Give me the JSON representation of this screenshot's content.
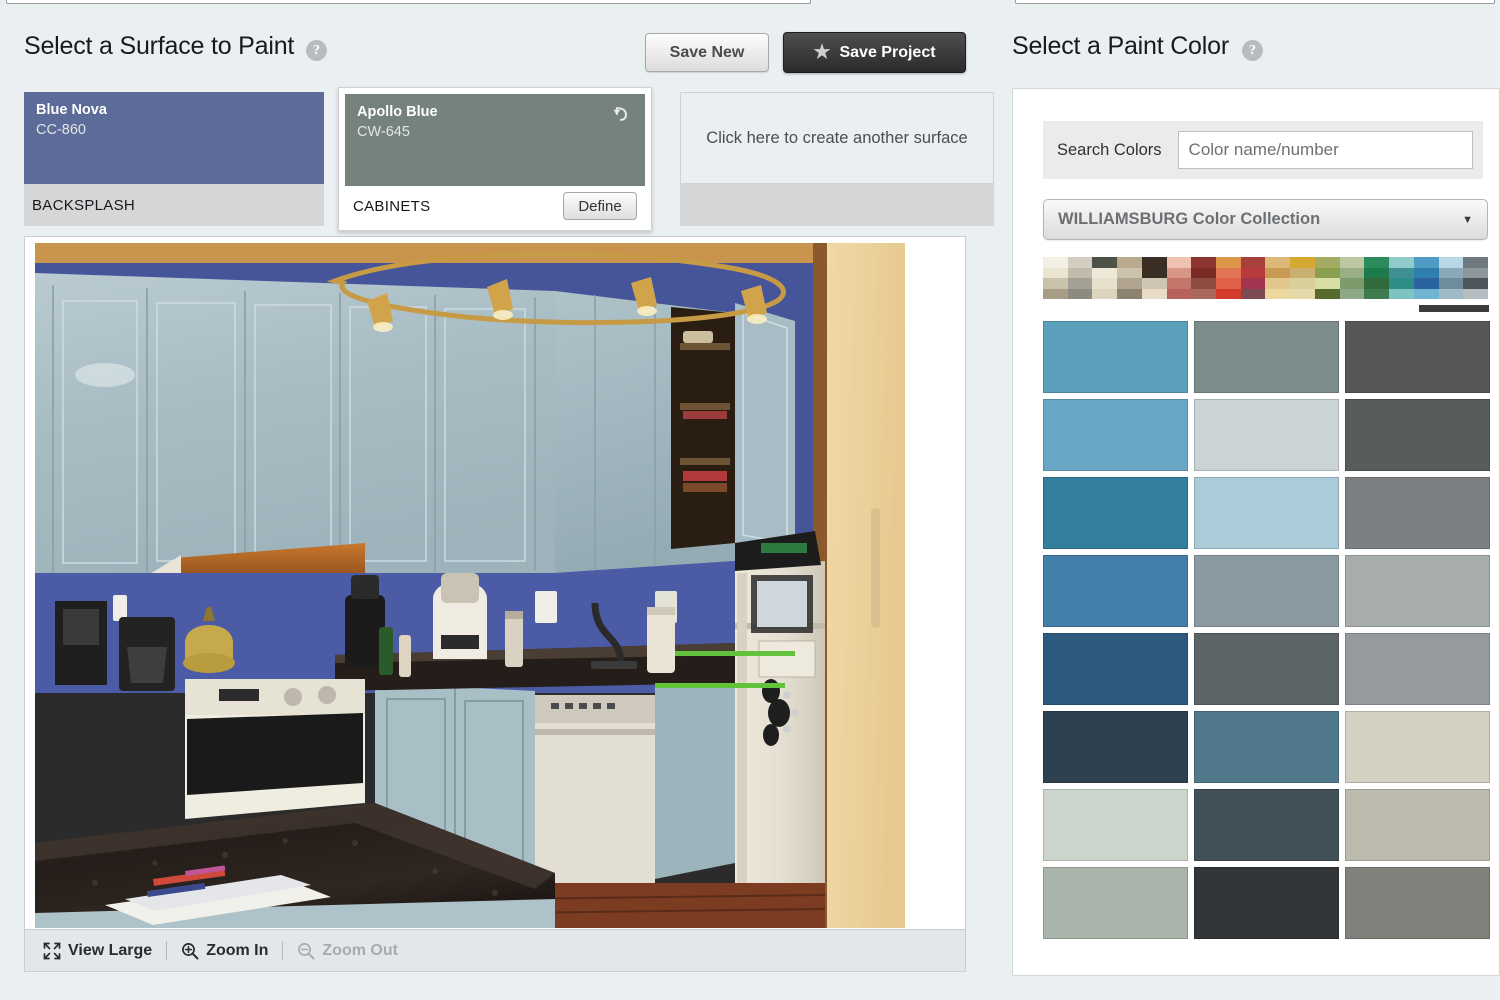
{
  "left": {
    "title": "Select a Surface to Paint",
    "help_icon": "help-icon",
    "save_new_label": "Save New",
    "save_project_label": "Save Project",
    "star_glyph": "★",
    "surfaces": [
      {
        "color_name": "Blue Nova",
        "color_code": "CC-860",
        "label": "BACKSPLASH",
        "hex": "#5c6b97",
        "selected": false
      },
      {
        "color_name": "Apollo Blue",
        "color_code": "CW-645",
        "label": "CABINETS",
        "hex": "#76837d",
        "selected": true,
        "define_label": "Define",
        "undo_icon": "undo-arrow-icon"
      }
    ],
    "create_surface_text": "Click here to create another surface",
    "toolbar": {
      "view_large": "View Large",
      "zoom_in": "Zoom In",
      "zoom_out": "Zoom Out",
      "zoom_out_disabled": true
    }
  },
  "right": {
    "title": "Select a Paint Color",
    "help_icon": "help-icon",
    "search_label": "Search Colors",
    "search_value": "",
    "search_placeholder": "Color name/number",
    "collection_label": "WILLIAMSBURG Color Collection",
    "caret_glyph": "▼",
    "family_strip": [
      [
        "#f2f0e4",
        "#eae4d3",
        "#c9c3ac",
        "#a79c86"
      ],
      [
        "#d4cec2",
        "#c1bbae",
        "#a3a096",
        "#8d8a80"
      ],
      [
        "#4e5246",
        "#eee8d8",
        "#e7e0cc",
        "#ddd4bd"
      ],
      [
        "#b9a98d",
        "#cdc2ac",
        "#b0a491",
        "#8d8270"
      ],
      [
        "#3a2e25",
        "#3a2e25",
        "#cfc5b2",
        "#e8dcc6"
      ],
      [
        "#efc2b2",
        "#d89686",
        "#c4756a",
        "#b5615c"
      ],
      [
        "#8d3530",
        "#7a2b26",
        "#8e4b3f",
        "#a9685a"
      ],
      [
        "#dd9648",
        "#e07555",
        "#e06048",
        "#d23a2a"
      ],
      [
        "#a8403c",
        "#b93a3c",
        "#a33551",
        "#7d4a52"
      ],
      [
        "#ddb878",
        "#c99a54",
        "#e1c78b",
        "#ecd79e"
      ],
      [
        "#d5a82f",
        "#c9b070",
        "#d9cf9c",
        "#e5daa9"
      ],
      [
        "#a4ab63",
        "#8aa04f",
        "#d9dda6",
        "#566b2c"
      ],
      [
        "#bcc6a3",
        "#9aae86",
        "#7d9a6a",
        "#8fa987"
      ],
      [
        "#2b8b5d",
        "#1d7a4a",
        "#2f6b3c",
        "#3f7b51"
      ],
      [
        "#8fcbc8",
        "#3f8f93",
        "#2e8e86",
        "#7cc3c1"
      ],
      [
        "#4f9cc4",
        "#2f7fae",
        "#2b63a0",
        "#6fb4d2"
      ],
      [
        "#b9d8e5",
        "#8aa8b8",
        "#6e8c9c",
        "#9fb9c6"
      ],
      [
        "#6e7a80",
        "#8e979b",
        "#4c565c",
        "#b5bbbe"
      ]
    ],
    "swatches": [
      "#5ba0bb",
      "#7c8c8b",
      "#555759",
      "#6aa7c6",
      "#cad3d6",
      "#575d5c",
      "#357f9e",
      "#abcbd9",
      "#7d8082",
      "#447fa9",
      "#8b99a1",
      "#a6adaa",
      "#2f5a7f",
      "#5b6467",
      "#959a9d",
      "#2e4151",
      "#51798c",
      "#d4d0c2",
      "#ccd6cd",
      "#414f57",
      "#bcbbae",
      "#a9b5aa",
      "#333638",
      "#80817a"
    ]
  }
}
